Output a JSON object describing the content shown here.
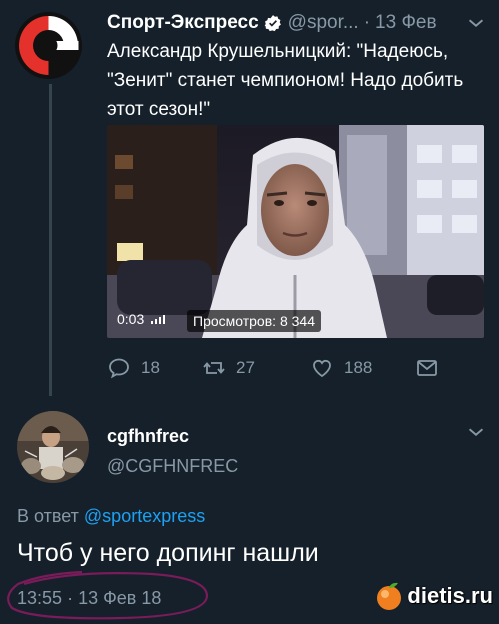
{
  "original_tweet": {
    "author_name": "Спорт-Экспресс",
    "handle": "@spor...",
    "separator": "·",
    "date": "13 Фев",
    "text": "Александр Крушельницкий: \"Надеюсь, \"Зенит\" станет чемпионом! Надо добить этот сезон!\"",
    "video": {
      "duration": "0:03",
      "views": "Просмотров: 8 344"
    },
    "actions": {
      "replies": "18",
      "retweets": "27",
      "likes": "188"
    }
  },
  "reply_tweet": {
    "author_name": "cgfhnfrec",
    "handle": "@CGFHNFREC",
    "in_reply_prefix": "В ответ",
    "in_reply_mention": "@sportexpress",
    "text": "Чтоб у него допинг нашли",
    "time": "13:55",
    "separator": "·",
    "date": "13 Фев 18"
  },
  "watermark": "dietis.ru",
  "colors": {
    "background": "#15202b",
    "secondary_text": "#8899a6",
    "link": "#1da1f2",
    "verified": "#1da1f2",
    "annotation_circle": "#7a1b5a"
  },
  "icons": [
    "sport-express-logo",
    "verified-icon",
    "chevron-down-icon",
    "reply-icon",
    "retweet-icon",
    "like-icon",
    "share-icon",
    "diets-logo"
  ]
}
